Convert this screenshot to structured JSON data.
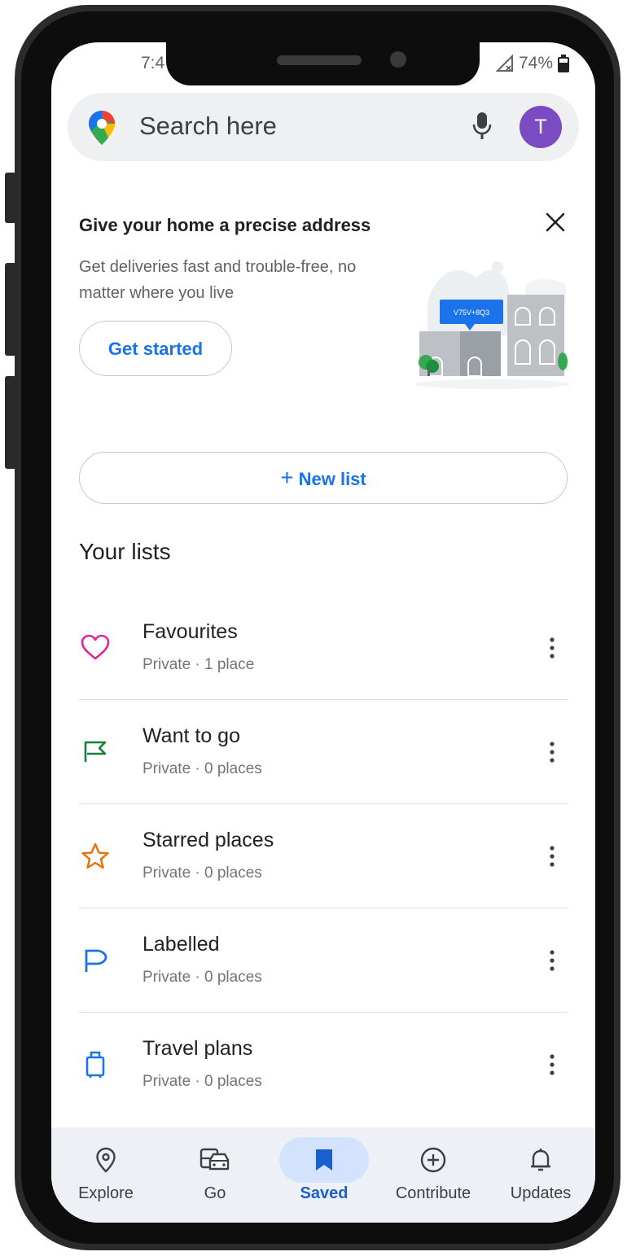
{
  "status_bar": {
    "time": "7:4",
    "battery": "74%"
  },
  "search": {
    "placeholder": "Search here",
    "avatar_initial": "T"
  },
  "promo": {
    "title": "Give your home a precise address",
    "text": "Get deliveries fast and trouble-free, no matter where you live",
    "button": "Get started",
    "plus_code": "V75V+8Q3"
  },
  "new_list": {
    "plus": "+",
    "label": "New list"
  },
  "lists_heading": "Your lists",
  "lists": [
    {
      "name": "Favourites",
      "sub": "Private · 1 place",
      "icon": "heart-icon",
      "color": "#e52592"
    },
    {
      "name": "Want to go",
      "sub": "Private · 0 places",
      "icon": "flag-icon",
      "color": "#188038"
    },
    {
      "name": "Starred places",
      "sub": "Private · 0 places",
      "icon": "star-icon",
      "color": "#e8710a"
    },
    {
      "name": "Labelled",
      "sub": "Private · 0 places",
      "icon": "label-flag-icon",
      "color": "#1a73e8"
    },
    {
      "name": "Travel plans",
      "sub": "Private · 0 places",
      "icon": "suitcase-icon",
      "color": "#1a73e8"
    }
  ],
  "nav": [
    {
      "label": "Explore",
      "icon": "location-pin-icon",
      "active": false
    },
    {
      "label": "Go",
      "icon": "commute-icon",
      "active": false
    },
    {
      "label": "Saved",
      "icon": "bookmark-icon",
      "active": true
    },
    {
      "label": "Contribute",
      "icon": "add-circle-icon",
      "active": false
    },
    {
      "label": "Updates",
      "icon": "bell-icon",
      "active": false
    }
  ],
  "colors": {
    "accent": "#1a73e8",
    "avatar": "#7b4bc4",
    "nav_bg": "#edf1f6",
    "nav_active": "#d3e3fd"
  }
}
